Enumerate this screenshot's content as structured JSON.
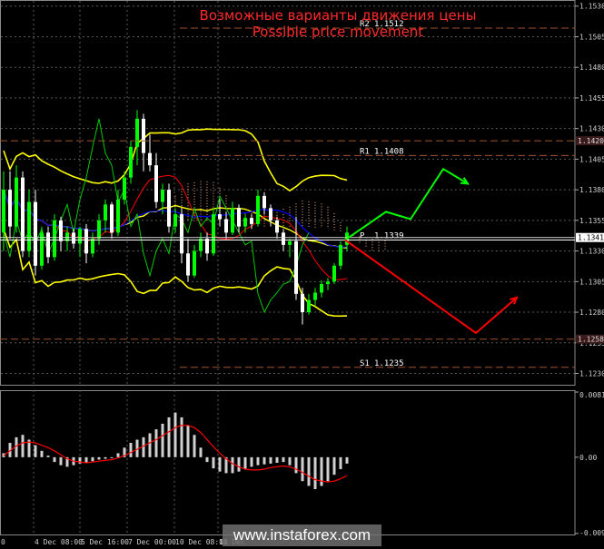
{
  "title": {
    "ru": "Возможные варианты движения цены",
    "en": "Possible price movement",
    "color": "#ff2a2a"
  },
  "watermark": "www.instaforex.com",
  "colors": {
    "background": "#000000",
    "grid": "#5a5a5a",
    "axis_text": "#cfcfcf",
    "candle_bull": "#00ff00",
    "candle_bear": "#ffffff",
    "bollinger": "#ffff00",
    "middle_band": "#ffff00",
    "tenkan": "#ff0000",
    "kijun": "#0000ff",
    "chikou": "#00cc00",
    "cloud": "#ffb37f",
    "forecast_up": "#00ff00",
    "forecast_down": "#ff0000",
    "pivot_line": "#ffffff",
    "level_line": "#a0522d",
    "macd_hist": "#d0d0d0",
    "macd_signal": "#ff0000"
  },
  "chart_data": [
    {
      "type": "candlestick",
      "symbol": "EUR/USD H4",
      "y_ticks": [
        "1.1530",
        "1.1505",
        "1.1480",
        "1.1455",
        "1.1430",
        "1.1405",
        "1.1380",
        "1.1355",
        "1.1330",
        "1.1305",
        "1.1280",
        "1.1255",
        "1.1230"
      ],
      "ylim": [
        1.122,
        1.1535
      ],
      "x_ticks": [
        "0",
        "4 Dec 08:00",
        "5 Dec 16:00",
        "7 Dec 00:00",
        "10 Dec 08:00",
        "11 Dec"
      ],
      "levels": [
        {
          "label": "R2",
          "value": "1.1512"
        },
        {
          "label": "R1",
          "value": "1.1408"
        },
        {
          "label": "P",
          "value": "1.1339"
        },
        {
          "label": "S1",
          "value": "1.1235"
        }
      ],
      "price_marks": [
        "1.1420",
        "1.1341",
        "1.1258"
      ],
      "candles_ohlc": [
        [
          1.1345,
          1.1395,
          1.133,
          1.138
        ],
        [
          1.138,
          1.1395,
          1.134,
          1.135
        ],
        [
          1.135,
          1.14,
          1.1345,
          1.139
        ],
        [
          1.139,
          1.1395,
          1.1325,
          1.133
        ],
        [
          1.133,
          1.138,
          1.1325,
          1.137
        ],
        [
          1.137,
          1.138,
          1.131,
          1.1318
        ],
        [
          1.1318,
          1.135,
          1.1315,
          1.1345
        ],
        [
          1.1345,
          1.135,
          1.132,
          1.1325
        ],
        [
          1.1325,
          1.136,
          1.1322,
          1.1355
        ],
        [
          1.1355,
          1.1358,
          1.133,
          1.1338
        ],
        [
          1.1338,
          1.135,
          1.133,
          1.1345
        ],
        [
          1.1345,
          1.1348,
          1.1332,
          1.1336
        ],
        [
          1.1336,
          1.135,
          1.1325,
          1.1348
        ],
        [
          1.1348,
          1.1352,
          1.132,
          1.1328
        ],
        [
          1.1328,
          1.1345,
          1.1325,
          1.134
        ],
        [
          1.134,
          1.136,
          1.1335,
          1.1355
        ],
        [
          1.1355,
          1.1372,
          1.1345,
          1.1368
        ],
        [
          1.1368,
          1.137,
          1.134,
          1.1345
        ],
        [
          1.1345,
          1.138,
          1.1342,
          1.1372
        ],
        [
          1.1372,
          1.1395,
          1.1368,
          1.139
        ],
        [
          1.139,
          1.142,
          1.1385,
          1.1415
        ],
        [
          1.1415,
          1.1445,
          1.14,
          1.1438
        ],
        [
          1.1438,
          1.1442,
          1.1395,
          1.141
        ],
        [
          1.141,
          1.1425,
          1.1395,
          1.14
        ],
        [
          1.14,
          1.141,
          1.1365,
          1.137
        ],
        [
          1.137,
          1.1385,
          1.136,
          1.138
        ],
        [
          1.138,
          1.1385,
          1.1345,
          1.135
        ],
        [
          1.135,
          1.1365,
          1.1345,
          1.136
        ],
        [
          1.136,
          1.1365,
          1.132,
          1.1328
        ],
        [
          1.1328,
          1.134,
          1.1305,
          1.131
        ],
        [
          1.131,
          1.1335,
          1.1308,
          1.133
        ],
        [
          1.133,
          1.1345,
          1.1325,
          1.134
        ],
        [
          1.134,
          1.1345,
          1.1322,
          1.1328
        ],
        [
          1.1328,
          1.1365,
          1.1326,
          1.136
        ],
        [
          1.136,
          1.1372,
          1.135,
          1.1356
        ],
        [
          1.1356,
          1.1362,
          1.134,
          1.1345
        ],
        [
          1.1345,
          1.137,
          1.1343,
          1.1365
        ],
        [
          1.1365,
          1.1368,
          1.1345,
          1.135
        ],
        [
          1.135,
          1.136,
          1.1345,
          1.1357
        ],
        [
          1.1357,
          1.136,
          1.1348,
          1.1352
        ],
        [
          1.1352,
          1.138,
          1.135,
          1.1375
        ],
        [
          1.1375,
          1.1378,
          1.136,
          1.1365
        ],
        [
          1.1365,
          1.1368,
          1.135,
          1.1355
        ],
        [
          1.1355,
          1.1358,
          1.134,
          1.1345
        ],
        [
          1.1345,
          1.1348,
          1.133,
          1.1335
        ],
        [
          1.1335,
          1.134,
          1.1325,
          1.1338
        ],
        [
          1.1338,
          1.1358,
          1.129,
          1.1295
        ],
        [
          1.1295,
          1.13,
          1.127,
          1.128
        ],
        [
          1.128,
          1.1295,
          1.1278,
          1.129
        ],
        [
          1.129,
          1.13,
          1.1285,
          1.1296
        ],
        [
          1.1296,
          1.1306,
          1.1292,
          1.1303
        ],
        [
          1.1303,
          1.1308,
          1.1298,
          1.1305
        ],
        [
          1.1305,
          1.132,
          1.1303,
          1.1318
        ],
        [
          1.1318,
          1.1338,
          1.1315,
          1.1335
        ],
        [
          1.1335,
          1.135,
          1.133,
          1.1345
        ]
      ],
      "forecast_paths": {
        "up": [
          [
            1.1339,
            0
          ],
          [
            1.1362,
            5
          ],
          [
            1.1356,
            8
          ],
          [
            1.1397,
            12
          ],
          [
            1.1385,
            15
          ]
        ],
        "down": [
          [
            1.1339,
            0
          ],
          [
            1.1263,
            16
          ],
          [
            1.1292,
            21
          ]
        ]
      }
    },
    {
      "type": "bar",
      "name": "MACD",
      "y_ticks": [
        "0.00817",
        "0.00",
        "-0.00956"
      ],
      "ylim": [
        -0.0098,
        0.0084
      ],
      "histogram": [
        0.0005,
        0.0018,
        0.0025,
        0.0028,
        0.0022,
        0.0015,
        0.0008,
        0.0002,
        -0.0006,
        -0.001,
        -0.0012,
        -0.001,
        -0.0008,
        -0.0007,
        -0.0005,
        -0.0003,
        -0.0002,
        0.0,
        0.0005,
        0.0012,
        0.0018,
        0.0022,
        0.0025,
        0.003,
        0.0035,
        0.0042,
        0.005,
        0.0056,
        0.005,
        0.004,
        0.0028,
        0.0012,
        -0.0006,
        -0.0014,
        -0.0018,
        -0.002,
        -0.002,
        -0.0018,
        -0.0015,
        -0.0012,
        -0.001,
        -0.0009,
        -0.0008,
        -0.0007,
        -0.0006,
        -0.001,
        -0.002,
        -0.003,
        -0.0036,
        -0.004,
        -0.0036,
        -0.003,
        -0.0022,
        -0.0015,
        -0.0008
      ],
      "signal": [
        0.0002,
        0.0008,
        0.0014,
        0.0018,
        0.0019,
        0.0018,
        0.0015,
        0.0012,
        0.0008,
        0.0003,
        -0.0002,
        -0.0005,
        -0.0006,
        -0.0007,
        -0.0006,
        -0.0005,
        -0.0004,
        -0.0003,
        -0.0001,
        0.0002,
        0.0006,
        0.001,
        0.0014,
        0.0018,
        0.0022,
        0.0027,
        0.0032,
        0.0037,
        0.004,
        0.004,
        0.0037,
        0.0031,
        0.0022,
        0.0013,
        0.0005,
        -0.0002,
        -0.0008,
        -0.0012,
        -0.0015,
        -0.0016,
        -0.0016,
        -0.0015,
        -0.0013,
        -0.0012,
        -0.0011,
        -0.0012,
        -0.0015,
        -0.0019,
        -0.0024,
        -0.0028,
        -0.003,
        -0.0031,
        -0.003,
        -0.0027,
        -0.0023
      ]
    }
  ]
}
